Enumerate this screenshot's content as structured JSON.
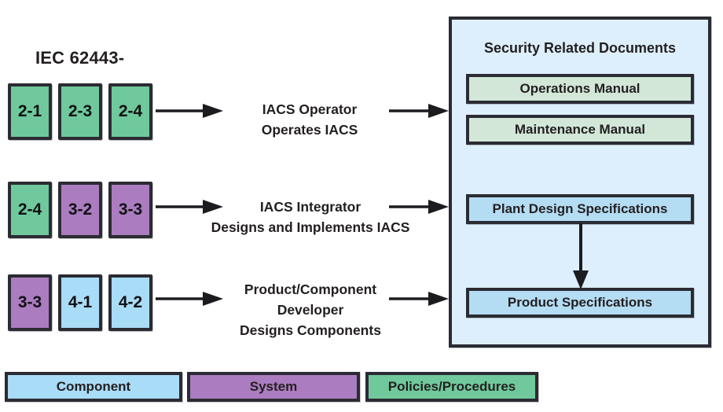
{
  "title": "IEC 62443-",
  "colors": {
    "component_blue": "#a9dcf6",
    "system_purple": "#ab7cbf",
    "policies_green": "#6fc99c",
    "panel_background": "#ddeffc",
    "document_green": "#d2e7d8",
    "specification_blue": "#b4ddf4",
    "outline": "#2b2b33",
    "text": "#231f20"
  },
  "rows": [
    {
      "id": "operator-row",
      "parts": [
        {
          "label": "2-1",
          "category": "policies"
        },
        {
          "label": "2-3",
          "category": "policies"
        },
        {
          "label": "2-4",
          "category": "policies"
        }
      ],
      "role_line1": "IACS Operator",
      "role_line2": "Operates IACS",
      "role_line3": ""
    },
    {
      "id": "integrator-row",
      "parts": [
        {
          "label": "2-4",
          "category": "policies"
        },
        {
          "label": "3-2",
          "category": "system"
        },
        {
          "label": "3-3",
          "category": "system"
        }
      ],
      "role_line1": "IACS Integrator",
      "role_line2": "Designs and Implements IACS",
      "role_line3": ""
    },
    {
      "id": "developer-row",
      "parts": [
        {
          "label": "3-3",
          "category": "system"
        },
        {
          "label": "4-1",
          "category": "component"
        },
        {
          "label": "4-2",
          "category": "component"
        }
      ],
      "role_line1": "Product/Component",
      "role_line2": "Developer",
      "role_line3": "Designs Components"
    }
  ],
  "panel": {
    "title": "Security Related Documents",
    "documents": [
      {
        "label": "Operations Manual",
        "category": "policies-doc"
      },
      {
        "label": "Maintenance Manual",
        "category": "policies-doc"
      },
      {
        "label": "Plant Design Specifications",
        "category": "component-doc"
      },
      {
        "label": "Product Specifications",
        "category": "component-doc"
      }
    ]
  },
  "legend": [
    {
      "label": "Component",
      "color_key": "component_blue"
    },
    {
      "label": "System",
      "color_key": "system_purple"
    },
    {
      "label": "Policies/Procedures",
      "color_key": "policies_green"
    }
  ]
}
